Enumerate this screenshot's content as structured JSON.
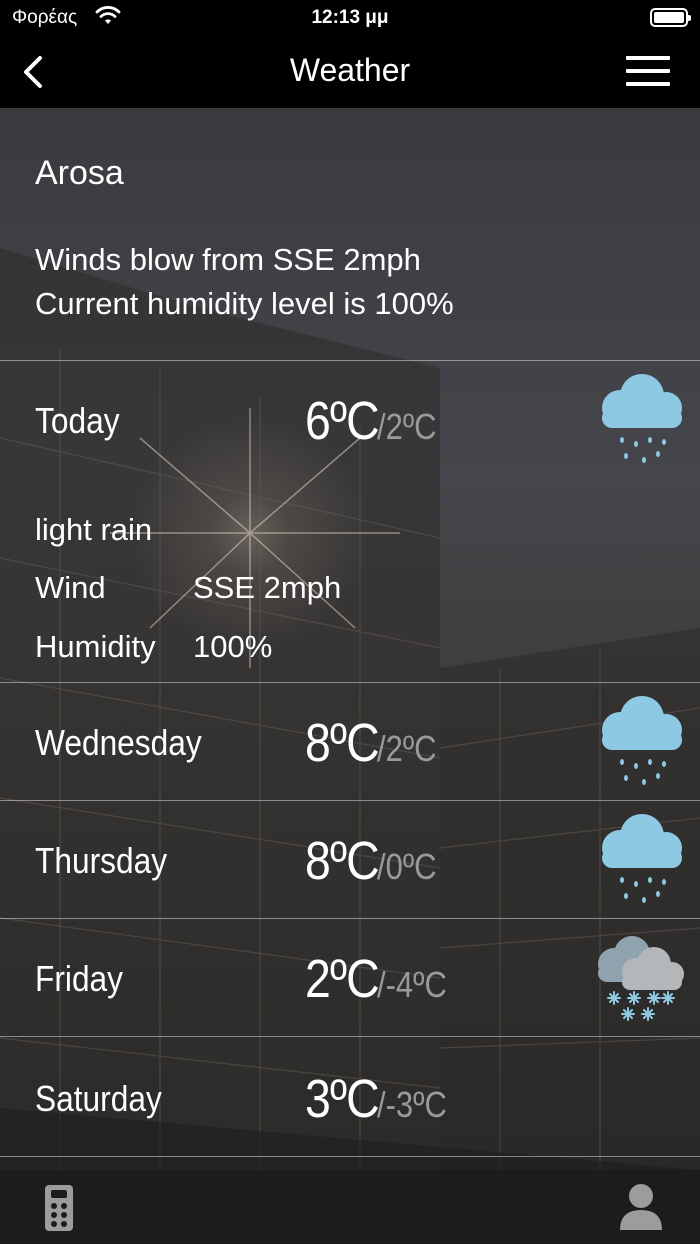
{
  "status_bar": {
    "carrier": "Φορέας",
    "time": "12:13 μμ",
    "icons": [
      "wifi-icon",
      "battery-icon"
    ]
  },
  "nav": {
    "title": "Weather",
    "back_icon": "chevron-left-icon",
    "menu_icon": "hamburger-menu-icon"
  },
  "location": {
    "city": "Arosa",
    "wind_line": "Winds blow from SSE 2mph",
    "humidity_line": "Current humidity level is 100%"
  },
  "today": {
    "label": "Today",
    "high": "6ºC",
    "low": "/2ºC",
    "condition": "light rain",
    "wind_label": "Wind",
    "wind_value": "SSE 2mph",
    "humidity_label": "Humidity",
    "humidity_value": "100%",
    "icon": "rain-cloud-icon"
  },
  "forecast": [
    {
      "day": "Wednesday",
      "high": "8ºC",
      "low": "/2ºC",
      "icon": "rain-cloud-icon"
    },
    {
      "day": "Thursday",
      "high": "8ºC",
      "low": "/0ºC",
      "icon": "rain-cloud-icon"
    },
    {
      "day": "Friday",
      "high": "2ºC",
      "low": "/-4ºC",
      "icon": "snow-cloud-icon"
    },
    {
      "day": "Saturday",
      "high": "3ºC",
      "low": "/-3ºC",
      "icon": ""
    }
  ],
  "tab_bar": {
    "left_icon": "remote-control-icon",
    "right_icon": "user-icon"
  },
  "colors": {
    "bar_background": "#000000",
    "tab_bar_background": "#1c1c1c",
    "icon_blue": "#8ec9e3",
    "low_temp_gray": "#9a9a9a"
  }
}
